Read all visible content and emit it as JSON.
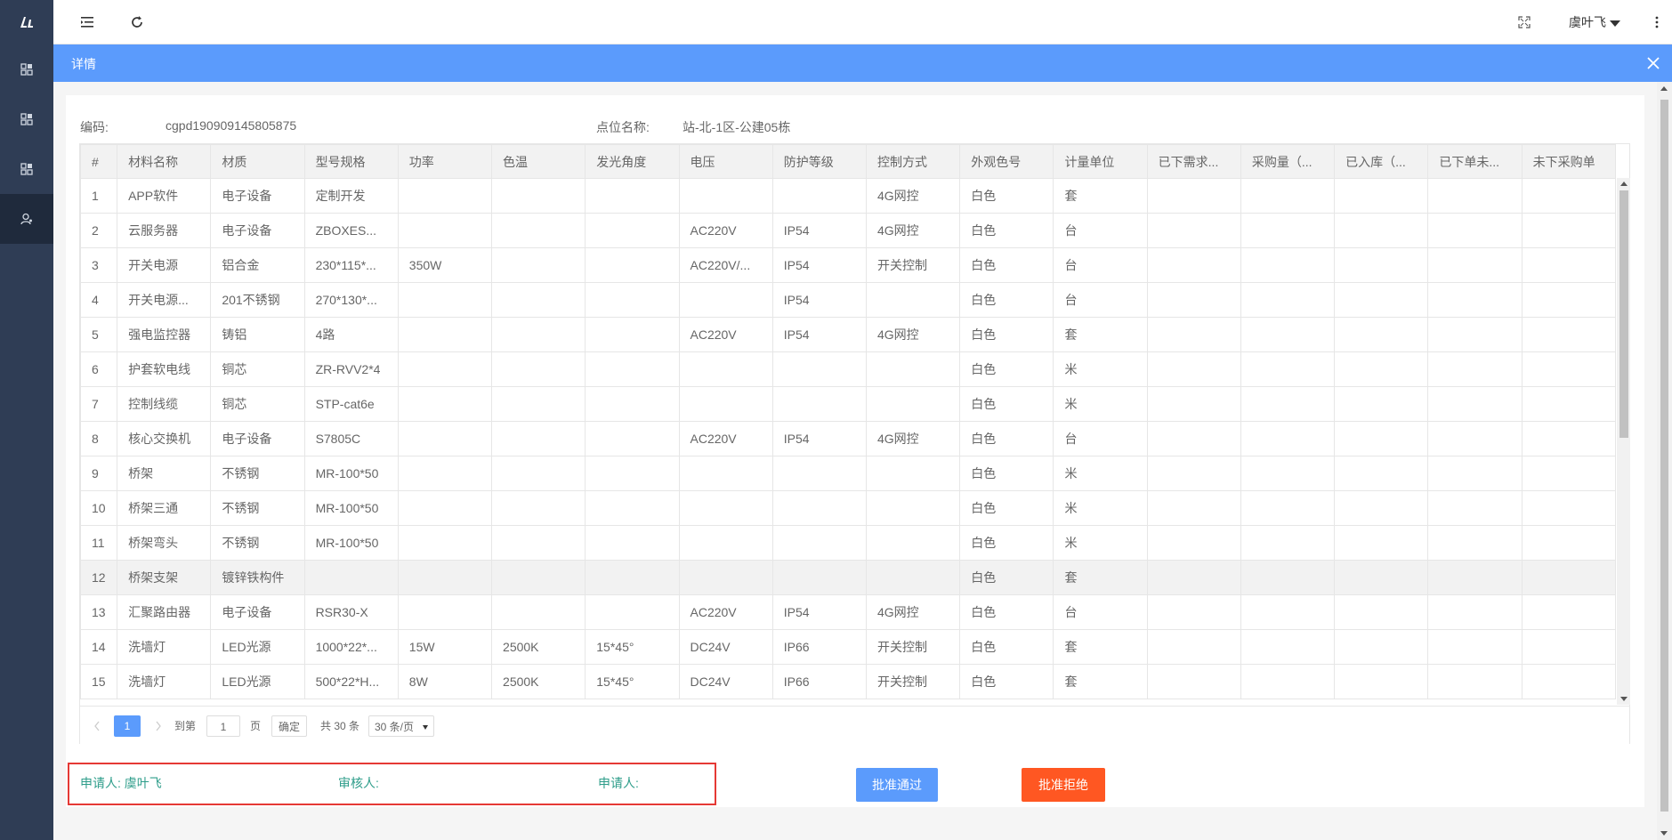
{
  "topbar": {
    "user_name": "虞叶飞",
    "icons": [
      "menu-fold-icon",
      "refresh-icon",
      "fullscreen-icon",
      "more-icon"
    ]
  },
  "sidebar": {
    "items": [
      {
        "icon": "grid-icon"
      },
      {
        "icon": "grid-icon"
      },
      {
        "icon": "grid-icon"
      },
      {
        "icon": "user-icon",
        "active": true
      }
    ]
  },
  "dialog": {
    "title": "详情",
    "code_label": "编码:",
    "code_value": "cgpd190909145805875",
    "location_label": "点位名称:",
    "location_value": "站-北-1区-公建05栋"
  },
  "table": {
    "columns": [
      "#",
      "材料名称",
      "材质",
      "型号规格",
      "功率",
      "色温",
      "发光角度",
      "电压",
      "防护等级",
      "控制方式",
      "外观色号",
      "计量单位",
      "已下需求...",
      "采购量（...",
      "已入库（...",
      "已下单未...",
      "未下采购单"
    ],
    "rows": [
      [
        "1",
        "APP软件",
        "电子设备",
        "定制开发",
        "",
        "",
        "",
        "",
        "",
        "4G网控",
        "白色",
        "套",
        "",
        "",
        "",
        "",
        ""
      ],
      [
        "2",
        "云服务器",
        "电子设备",
        "ZBOXES...",
        "",
        "",
        "",
        "AC220V",
        "IP54",
        "4G网控",
        "白色",
        "台",
        "",
        "",
        "",
        "",
        ""
      ],
      [
        "3",
        "开关电源",
        "铝合金",
        "230*115*...",
        "350W",
        "",
        "",
        "AC220V/...",
        "IP54",
        "开关控制",
        "白色",
        "台",
        "",
        "",
        "",
        "",
        ""
      ],
      [
        "4",
        "开关电源...",
        "201不锈钢",
        "270*130*...",
        "",
        "",
        "",
        "",
        "IP54",
        "",
        "白色",
        "台",
        "",
        "",
        "",
        "",
        ""
      ],
      [
        "5",
        "强电监控器",
        "铸铝",
        "4路",
        "",
        "",
        "",
        "AC220V",
        "IP54",
        "4G网控",
        "白色",
        "套",
        "",
        "",
        "",
        "",
        ""
      ],
      [
        "6",
        "护套软电线",
        "铜芯",
        "ZR-RVV2*4",
        "",
        "",
        "",
        "",
        "",
        "",
        "白色",
        "米",
        "",
        "",
        "",
        "",
        ""
      ],
      [
        "7",
        "控制线缆",
        "铜芯",
        "STP-cat6e",
        "",
        "",
        "",
        "",
        "",
        "",
        "白色",
        "米",
        "",
        "",
        "",
        "",
        ""
      ],
      [
        "8",
        "核心交换机",
        "电子设备",
        "S7805C",
        "",
        "",
        "",
        "AC220V",
        "IP54",
        "4G网控",
        "白色",
        "台",
        "",
        "",
        "",
        "",
        ""
      ],
      [
        "9",
        "桥架",
        "不锈钢",
        "MR-100*50",
        "",
        "",
        "",
        "",
        "",
        "",
        "白色",
        "米",
        "",
        "",
        "",
        "",
        ""
      ],
      [
        "10",
        "桥架三通",
        "不锈钢",
        "MR-100*50",
        "",
        "",
        "",
        "",
        "",
        "",
        "白色",
        "米",
        "",
        "",
        "",
        "",
        ""
      ],
      [
        "11",
        "桥架弯头",
        "不锈钢",
        "MR-100*50",
        "",
        "",
        "",
        "",
        "",
        "",
        "白色",
        "米",
        "",
        "",
        "",
        "",
        ""
      ],
      [
        "12",
        "桥架支架",
        "镀锌铁构件",
        "",
        "",
        "",
        "",
        "",
        "",
        "",
        "白色",
        "套",
        "",
        "",
        "",
        "",
        ""
      ],
      [
        "13",
        "汇聚路由器",
        "电子设备",
        "RSR30-X",
        "",
        "",
        "",
        "AC220V",
        "IP54",
        "4G网控",
        "白色",
        "台",
        "",
        "",
        "",
        "",
        ""
      ],
      [
        "14",
        "洗墙灯",
        "LED光源",
        "1000*22*...",
        "15W",
        "2500K",
        "15*45°",
        "DC24V",
        "IP66",
        "开关控制",
        "白色",
        "套",
        "",
        "",
        "",
        "",
        ""
      ],
      [
        "15",
        "洗墙灯",
        "LED光源",
        "500*22*H...",
        "8W",
        "2500K",
        "15*45°",
        "DC24V",
        "IP66",
        "开关控制",
        "白色",
        "套",
        "",
        "",
        "",
        "",
        ""
      ]
    ],
    "highlight_row": 12
  },
  "pager": {
    "current_page": "1",
    "goto_label": "到第",
    "goto_value": "1",
    "page_label": "页",
    "confirm_label": "确定",
    "total_label": "共 30 条",
    "page_size": "30 条/页"
  },
  "footer": {
    "applicant_label": "申请人: 虞叶飞",
    "reviewer_label": "审核人:",
    "applicant2_label": "申请人:",
    "approve_label": "批准通过",
    "reject_label": "批准拒绝"
  },
  "colors": {
    "accent": "#5b9bfc",
    "danger": "#ff5722",
    "sidebar": "#2f3d55",
    "label_green": "#2e9d8a"
  }
}
